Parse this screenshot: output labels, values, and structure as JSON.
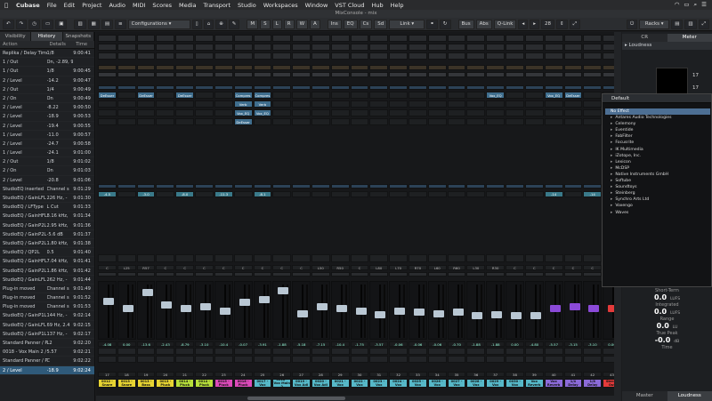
{
  "menubar": {
    "items": [
      "Cubase",
      "File",
      "Edit",
      "Project",
      "Audio",
      "MIDI",
      "Scores",
      "Media",
      "Transport",
      "Studio",
      "Workspaces",
      "Window",
      "VST Cloud",
      "Hub",
      "Help"
    ]
  },
  "window_title": "MixConsole - mix",
  "toolbar": {
    "configurations": "Configurations",
    "buttons": [
      "M",
      "S",
      "L",
      "R",
      "W",
      "A"
    ],
    "ins": "Ins",
    "eq": "EQ",
    "cs": "Cs",
    "sd": "Sd",
    "link": "Link",
    "bus": "Bus",
    "abs": "Abs",
    "qlink": "Q-Link",
    "channel_count": "28",
    "racks": "Racks"
  },
  "left_panel": {
    "tabs": [
      "Visibility",
      "History",
      "Snapshots"
    ],
    "columns": [
      "Action",
      "Details",
      "Time"
    ],
    "rows": [
      {
        "a": "Replika / Delay Time",
        "d": "1/8",
        "t": "9:00:41"
      },
      {
        "a": "1 / Out",
        "d": "On, -2.89, 9:00:41",
        "t": ""
      },
      {
        "a": "1 / Out",
        "d": "1/8",
        "t": "9:00:45"
      },
      {
        "a": "2 / Level",
        "d": "-14.2",
        "t": "9:00:47"
      },
      {
        "a": "2 / Out",
        "d": "1/4",
        "t": "9:00:49"
      },
      {
        "a": "2 / On",
        "d": "On",
        "t": "9:00:49"
      },
      {
        "a": "2 / Level",
        "d": "-8.22",
        "t": "9:00:50"
      },
      {
        "a": "2 / Level",
        "d": "-18.9",
        "t": "9:00:53"
      },
      {
        "a": "2 / Level",
        "d": "-19.4",
        "t": "9:00:55"
      },
      {
        "a": "1 / Level",
        "d": "-11.0",
        "t": "9:00:57"
      },
      {
        "a": "2 / Level",
        "d": "-24.7",
        "t": "9:00:58"
      },
      {
        "a": "1 / Level",
        "d": "-24.1",
        "t": "9:01:00"
      },
      {
        "a": "2 / Out",
        "d": "1/8",
        "t": "9:01:02"
      },
      {
        "a": "2 / On",
        "d": "On",
        "t": "9:01:03"
      },
      {
        "a": "2 / Level",
        "d": "-20.8",
        "t": "9:01:06"
      },
      {
        "a": "StudioEQ inserted",
        "d": "Channel s",
        "t": "9:01:29"
      },
      {
        "a": "StudioEQ / GainLFL",
        "d": "226 Hz, -",
        "t": "9:01:30"
      },
      {
        "a": "StudioEQ / LFType",
        "d": "L Cut",
        "t": "9:01:33"
      },
      {
        "a": "StudioEQ / GainHFL",
        "d": "8.16 kHz,",
        "t": "9:01:34"
      },
      {
        "a": "StudioEQ / GainP2L",
        "d": "2.95 kHz,",
        "t": "9:01:36"
      },
      {
        "a": "StudioEQ / GainP2L",
        "d": "-5.6 dB",
        "t": "9:01:37"
      },
      {
        "a": "StudioEQ / GainP2L",
        "d": "1.80 kHz,",
        "t": "9:01:38"
      },
      {
        "a": "StudioEQ / QP2L",
        "d": "0.5",
        "t": "9:01:40"
      },
      {
        "a": "StudioEQ / GainHFL",
        "d": "7.04 kHz,",
        "t": "9:01:41"
      },
      {
        "a": "StudioEQ / GainP2L",
        "d": "1.86 kHz,",
        "t": "9:01:42"
      },
      {
        "a": "StudioEQ / GainLFL",
        "d": "262 Hz, -",
        "t": "9:01:44"
      },
      {
        "a": "Plug-in moved",
        "d": "Channel s",
        "t": "9:01:49"
      },
      {
        "a": "Plug-in moved",
        "d": "Channel s",
        "t": "9:01:52"
      },
      {
        "a": "Plug-in moved",
        "d": "Channel s",
        "t": "9:01:53"
      },
      {
        "a": "StudioEQ / GainP1L",
        "d": "144 Hz, -",
        "t": "9:02:14"
      },
      {
        "a": "StudioEQ / GainLFL",
        "d": "69 Hz, 2.4",
        "t": "9:02:15"
      },
      {
        "a": "StudioEQ / GainP1L",
        "d": "137 Hz, -",
        "t": "9:02:17"
      },
      {
        "a": "Standard Panner / P",
        "d": "L2",
        "t": "9:02:20"
      },
      {
        "a": "0018 - Vox Main 2 /",
        "d": "5.57",
        "t": "9:02:21"
      },
      {
        "a": "Standard Panner / P",
        "d": "C",
        "t": "9:02:22"
      },
      {
        "a": "2 / Level",
        "d": "-18.9",
        "t": "9:02:24"
      }
    ]
  },
  "channels": [
    {
      "num": "17",
      "name": "0012 - Snare",
      "color": "#e7d432",
      "pan": "C",
      "vol": "-4.08",
      "ins": [
        "DeEsser",
        "",
        "",
        ""
      ],
      "send": "-4.5",
      "fader": 0.72
    },
    {
      "num": "18",
      "name": "0013 - Snare",
      "color": "#e7d432",
      "pan": "L25",
      "vol": "0.00",
      "ins": [
        "",
        "",
        "",
        ""
      ],
      "send": "",
      "fader": 0.55
    },
    {
      "num": "19",
      "name": "0013 - Bass",
      "color": "#e7d432",
      "pan": "R57",
      "vol": "-13.6",
      "ins": [
        "DeEsser",
        "",
        "",
        ""
      ],
      "send": "-3.0",
      "fader": 0.9
    },
    {
      "num": "20",
      "name": "0013 - Pluck",
      "color": "#e7d432",
      "pan": "C",
      "vol": "-2.43",
      "ins": [
        "",
        "",
        "",
        ""
      ],
      "send": "",
      "fader": 0.64
    },
    {
      "num": "21",
      "name": "0014 - Pluck",
      "color": "#b6df3a",
      "pan": "C",
      "vol": "-8.79",
      "ins": [
        "DeEsser",
        "",
        "",
        ""
      ],
      "send": "-8.0",
      "fader": 0.55
    },
    {
      "num": "22",
      "name": "0014 - Pluck",
      "color": "#b6df3a",
      "pan": "C",
      "vol": "-3.10",
      "ins": [
        "",
        "",
        "",
        ""
      ],
      "send": "",
      "fader": 0.6
    },
    {
      "num": "23",
      "name": "0015 - Pluck",
      "color": "#db4ab9",
      "pan": "C",
      "vol": "-10.4",
      "ins": [
        "",
        "",
        "",
        ""
      ],
      "send": "-11.3",
      "fader": 0.5
    },
    {
      "num": "24",
      "name": "0016 - Pluck",
      "color": "#db4ab9",
      "pan": "C",
      "vol": "-0.07",
      "ins": [
        "Compres",
        "Verb",
        "Vox_EQ",
        "DeEsser"
      ],
      "send": "",
      "fader": 0.7
    },
    {
      "num": "25",
      "name": "0017 - Vox",
      "color": "#56b8c8",
      "pan": "C",
      "vol": "-3.91",
      "ins": [
        "Compres",
        "Verb",
        "Vox_EQ",
        ""
      ],
      "send": "-8.1",
      "fader": 0.75
    },
    {
      "num": "26",
      "name": "0018 - Vox Main 2",
      "color": "#56b8c8",
      "pan": "C",
      "vol": "-1.88",
      "ins": [
        "",
        "",
        "",
        ""
      ],
      "send": "",
      "fader": 0.95
    },
    {
      "num": "27",
      "name": "0019 - Vox Adl",
      "color": "#56b8c8",
      "pan": "C",
      "vol": "-5.18",
      "ins": [
        "",
        "",
        "",
        ""
      ],
      "send": "",
      "fader": 0.45
    },
    {
      "num": "28",
      "name": "0020 - Vox Adl",
      "color": "#56b8c8",
      "pan": "L50",
      "vol": "-7.15",
      "ins": [
        "",
        "",
        "",
        ""
      ],
      "send": "",
      "fader": 0.6
    },
    {
      "num": "29",
      "name": "0021 - Vox",
      "color": "#56b8c8",
      "pan": "R50",
      "vol": "-10.4",
      "ins": [
        "",
        "",
        "",
        ""
      ],
      "send": "",
      "fader": 0.55
    },
    {
      "num": "30",
      "name": "0022 - Vox",
      "color": "#56b8c8",
      "pan": "C",
      "vol": "-1.75",
      "ins": [
        "",
        "",
        "",
        ""
      ],
      "send": "",
      "fader": 0.5
    },
    {
      "num": "31",
      "name": "0023 - Vox",
      "color": "#56b8c8",
      "pan": "L80",
      "vol": "-3.57",
      "ins": [
        "",
        "",
        "",
        ""
      ],
      "send": "",
      "fader": 0.42
    },
    {
      "num": "32",
      "name": "0024 - Vox",
      "color": "#56b8c8",
      "pan": "L70",
      "vol": "-0.06",
      "ins": [
        "",
        "",
        "",
        ""
      ],
      "send": "",
      "fader": 0.5
    },
    {
      "num": "33",
      "name": "0025 - Vox",
      "color": "#56b8c8",
      "pan": "R70",
      "vol": "-0.06",
      "ins": [
        "",
        "",
        "",
        ""
      ],
      "send": "",
      "fader": 0.48
    },
    {
      "num": "34",
      "name": "0026 - Vox",
      "color": "#56b8c8",
      "pan": "L60",
      "vol": "-0.06",
      "ins": [
        "",
        "",
        "",
        ""
      ],
      "send": "",
      "fader": 0.45
    },
    {
      "num": "35",
      "name": "0027 - Vox",
      "color": "#56b8c8",
      "pan": "R60",
      "vol": "-0.70",
      "ins": [
        "",
        "",
        "",
        ""
      ],
      "send": "",
      "fader": 0.48
    },
    {
      "num": "36",
      "name": "0028 - Vox",
      "color": "#56b8c8",
      "pan": "L30",
      "vol": "-1.88",
      "ins": [
        "",
        "",
        "",
        ""
      ],
      "send": "",
      "fader": 0.4
    },
    {
      "num": "37",
      "name": "0029 - Vox",
      "color": "#56b8c8",
      "pan": "R30",
      "vol": "-1.88",
      "ins": [
        "Vox_EQ",
        "",
        "",
        ""
      ],
      "send": "",
      "fader": 0.42
    },
    {
      "num": "38",
      "name": "0030 - Vox",
      "color": "#56b8c8",
      "pan": "C",
      "vol": "0.00",
      "ins": [
        "",
        "",
        "",
        ""
      ],
      "send": "",
      "fader": 0.4
    },
    {
      "num": "39",
      "name": "Vox Reverb",
      "color": "#56b8c8",
      "pan": "C",
      "vol": "-4.80",
      "ins": [
        "",
        "",
        "",
        ""
      ],
      "send": "",
      "fader": 0.4
    },
    {
      "num": "40",
      "name": "Vox Reverb",
      "color": "#8b6ad8",
      "pan": "C",
      "vol": "-5.57",
      "ins": [
        "Vox_EQ",
        "",
        "",
        ""
      ],
      "send": "-14",
      "fader": 0.55,
      "purple": true
    },
    {
      "num": "41",
      "name": "1/4 Delay",
      "color": "#8b6ad8",
      "pan": "C",
      "vol": "-3.15",
      "ins": [
        "DeEsser",
        "",
        "",
        ""
      ],
      "send": "",
      "fader": 0.6,
      "purple": true
    },
    {
      "num": "42",
      "name": "1/8 Delay",
      "color": "#8b6ad8",
      "pan": "C",
      "vol": "-3.10",
      "ins": [
        "",
        "",
        "",
        ""
      ],
      "send": "-14",
      "fader": 0.55,
      "purple": true
    },
    {
      "num": "43",
      "name": "Stereo Out",
      "color": "#e43a3a",
      "pan": "C",
      "vol": "0.00",
      "ins": [
        "",
        "",
        "",
        ""
      ],
      "send": "",
      "fader": 0.55,
      "red": true
    }
  ],
  "right_panel": {
    "racks_label": "Racks",
    "tabs": [
      "CR",
      "Meter"
    ],
    "loudness_header": "Loudness",
    "meter_top": "17",
    "meter_bottom": "17",
    "popup": {
      "default": "Default",
      "items": [
        {
          "label": "No Effect",
          "sel": true,
          "arrow": false
        },
        {
          "label": "Antares Audio Technologies",
          "arrow": true
        },
        {
          "label": "Celemony",
          "arrow": true
        },
        {
          "label": "Eventide",
          "arrow": true
        },
        {
          "label": "FabFilter",
          "arrow": true
        },
        {
          "label": "Focusrite",
          "arrow": true
        },
        {
          "label": "IK Multimedia",
          "arrow": true
        },
        {
          "label": "iZotope, Inc.",
          "arrow": true
        },
        {
          "label": "Lexicon",
          "arrow": true
        },
        {
          "label": "McDSP",
          "arrow": true
        },
        {
          "label": "Native Instruments GmbH",
          "arrow": true
        },
        {
          "label": "Softube",
          "arrow": true
        },
        {
          "label": "Soundtoys",
          "arrow": true
        },
        {
          "label": "Steinberg",
          "arrow": true
        },
        {
          "label": "Synchro Arts Ltd",
          "arrow": true
        },
        {
          "label": "Voxengo",
          "arrow": true
        },
        {
          "label": "Waves",
          "arrow": true
        }
      ]
    },
    "stats": {
      "short_term_label": "Short-Term",
      "short_term": "0.0",
      "integrated_label": "Integrated",
      "integrated": "0.0",
      "range_label": "Range",
      "range": "0.0",
      "true_peak_label": "True Peak",
      "true_peak": "-0.0",
      "time_label": "Time",
      "lufs": "LUFS",
      "lu": "LU",
      "db": "dB"
    },
    "bottom_tabs": [
      "Master",
      "Loudness"
    ]
  }
}
